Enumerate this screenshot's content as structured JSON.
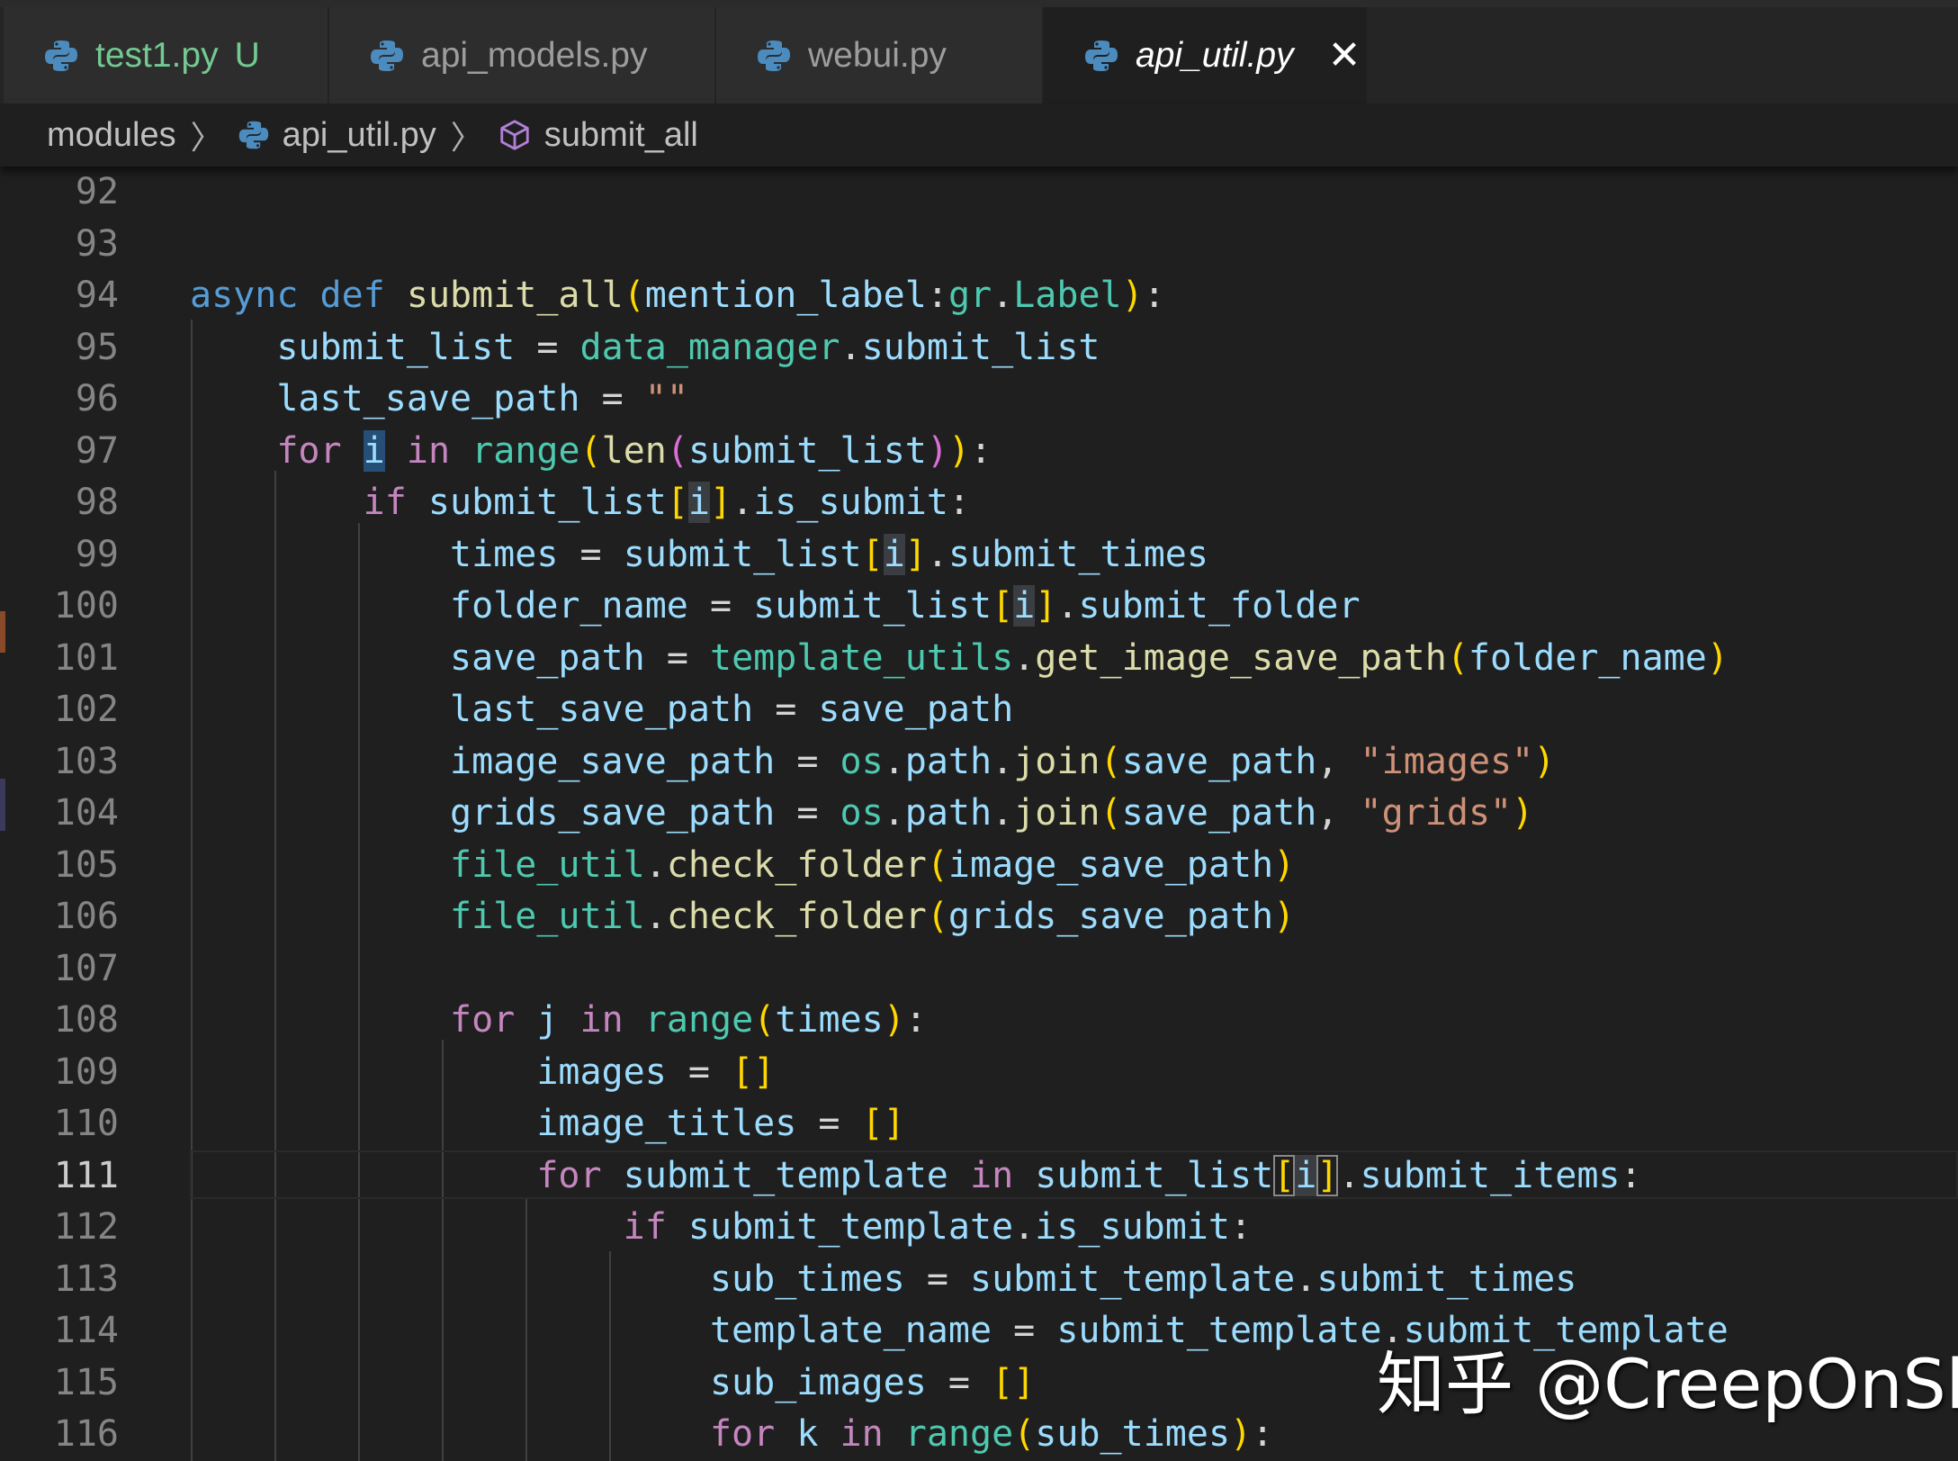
{
  "tabs": [
    {
      "label": "test1.py",
      "badge": "U"
    },
    {
      "label": "api_models.py"
    },
    {
      "label": "webui.py"
    },
    {
      "label": "api_util.py",
      "close": "✕"
    }
  ],
  "breadcrumb": {
    "folder": "modules",
    "file": "api_util.py",
    "symbol": "submit_all"
  },
  "line_numbers": [
    "92",
    "93",
    "94",
    "95",
    "96",
    "97",
    "98",
    "99",
    "100",
    "101",
    "102",
    "103",
    "104",
    "105",
    "106",
    "107",
    "108",
    "109",
    "110",
    "111",
    "112",
    "113",
    "114",
    "115",
    "116"
  ],
  "current_line": "111",
  "watermark": "知乎 @CreepOnSky",
  "colors": {
    "background": "#1f1f1f",
    "keyword": "#569cd6",
    "control": "#c586c0",
    "function": "#dcdcaa",
    "variable": "#9cdcfe",
    "module": "#4ec9b0",
    "string": "#ce9178"
  }
}
